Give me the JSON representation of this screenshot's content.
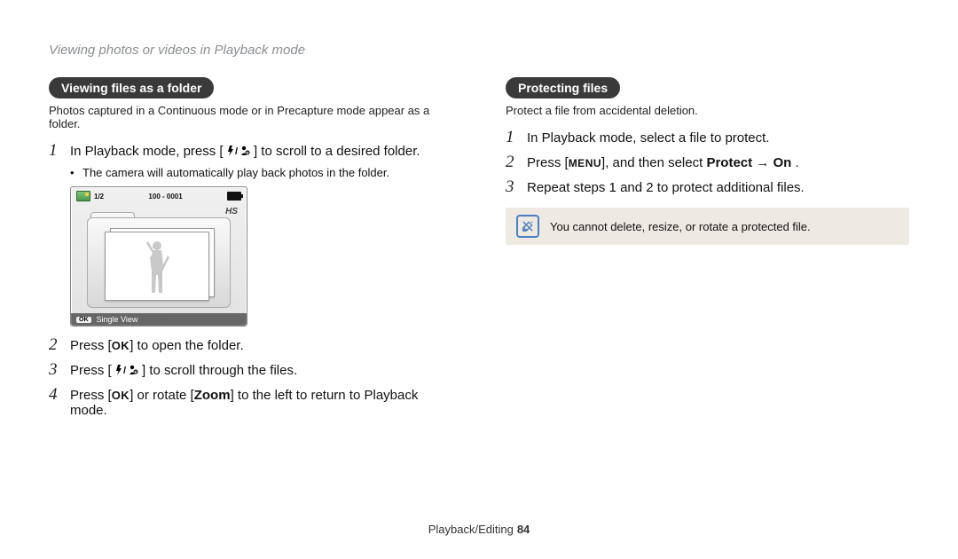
{
  "breadcrumb": "Viewing photos or videos in Playback mode",
  "left": {
    "heading": "Viewing files as a folder",
    "intro": "Photos captured in a Continuous mode or in Precapture mode appear as a folder.",
    "step1_pre": "In Playback mode, press [",
    "step1_post": "] to scroll to a desired folder.",
    "bullet1": "The camera will automatically play back photos in the folder.",
    "lcd": {
      "counter": "1/2",
      "filecode": "100 - 0001",
      "hs": "HS",
      "bottom_label": "Single View"
    },
    "step2_pre": "Press [",
    "step2_post": "] to open the folder.",
    "step3_pre": "Press [",
    "step3_post": "] to scroll through the files.",
    "step4_pre": "Press [",
    "step4_mid": "] or rotate [",
    "step4_zoom": "Zoom",
    "step4_post": "] to the left to return to Playback mode."
  },
  "right": {
    "heading": "Protecting files",
    "intro": "Protect a file from accidental deletion.",
    "step1": "In Playback mode, select a file to protect.",
    "step2_pre": "Press [",
    "step2_mid": "], and then select ",
    "step2_protect": "Protect",
    "step2_arrow": " → ",
    "step2_on": "On",
    "step2_post": " .",
    "step3": "Repeat steps 1 and 2 to protect additional files.",
    "note": "You cannot delete, resize, or rotate a protected file."
  },
  "buttons": {
    "flash_timer": "⚡/👤",
    "ok": "OK",
    "menu": "MENU"
  },
  "footer": {
    "section": "Playback/Editing",
    "page": "84"
  }
}
